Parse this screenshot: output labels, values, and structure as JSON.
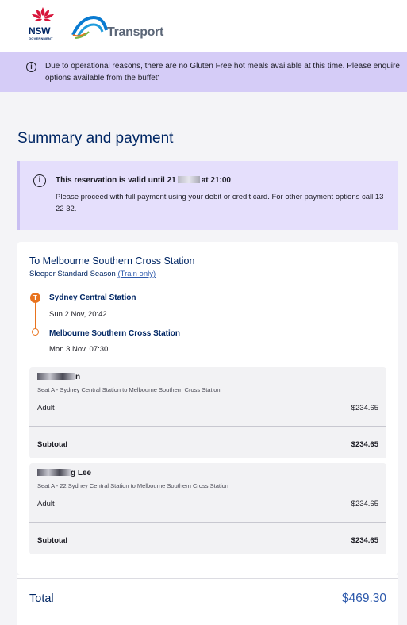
{
  "brand": {
    "nsw_text": "NSW",
    "nsw_sub": "GOVERNMENT",
    "transport_text": "Transport",
    "nsw_red": "#d7153a",
    "navy": "#002664"
  },
  "notice": {
    "icon": "info-icon",
    "line1": "Due to operational reasons, there are no Gluten Free hot meals available at this time. Please enquire",
    "line2": "options available from the buffet'"
  },
  "page": {
    "title": "Summary and payment"
  },
  "alert": {
    "icon": "info-icon",
    "title_prefix": "This reservation is valid until 21",
    "title_suffix": "at 21:00",
    "body": "Please proceed with full payment using your debit or credit card. For other payment options call 13 22 32."
  },
  "trip": {
    "destination_title": "To Melbourne Southern Cross Station",
    "fare_name": "Sleeper Standard Season",
    "fare_link": "(Train only)",
    "origin_station": "Sydney Central Station",
    "origin_time": "Sun 2 Nov, 20:42",
    "dest_station": "Melbourne Southern Cross Station",
    "dest_time": "Mon 3 Nov, 07:30",
    "accent": "#e8731e"
  },
  "passengers": [
    {
      "name_visible": "n",
      "seat": "Seat A - Sydney Central Station to Melbourne Southern Cross Station",
      "fare_type": "Adult",
      "fare_amount": "$234.65",
      "subtotal_label": "Subtotal",
      "subtotal_amount": "$234.65"
    },
    {
      "name_visible": "g Lee",
      "seat": "Seat A - 22 Sydney Central Station to Melbourne Southern Cross Station",
      "fare_type": "Adult",
      "fare_amount": "$234.65",
      "subtotal_label": "Subtotal",
      "subtotal_amount": "$234.65"
    }
  ],
  "total": {
    "label": "Total",
    "amount": "$469.30",
    "amount_color": "#2e5aac"
  }
}
